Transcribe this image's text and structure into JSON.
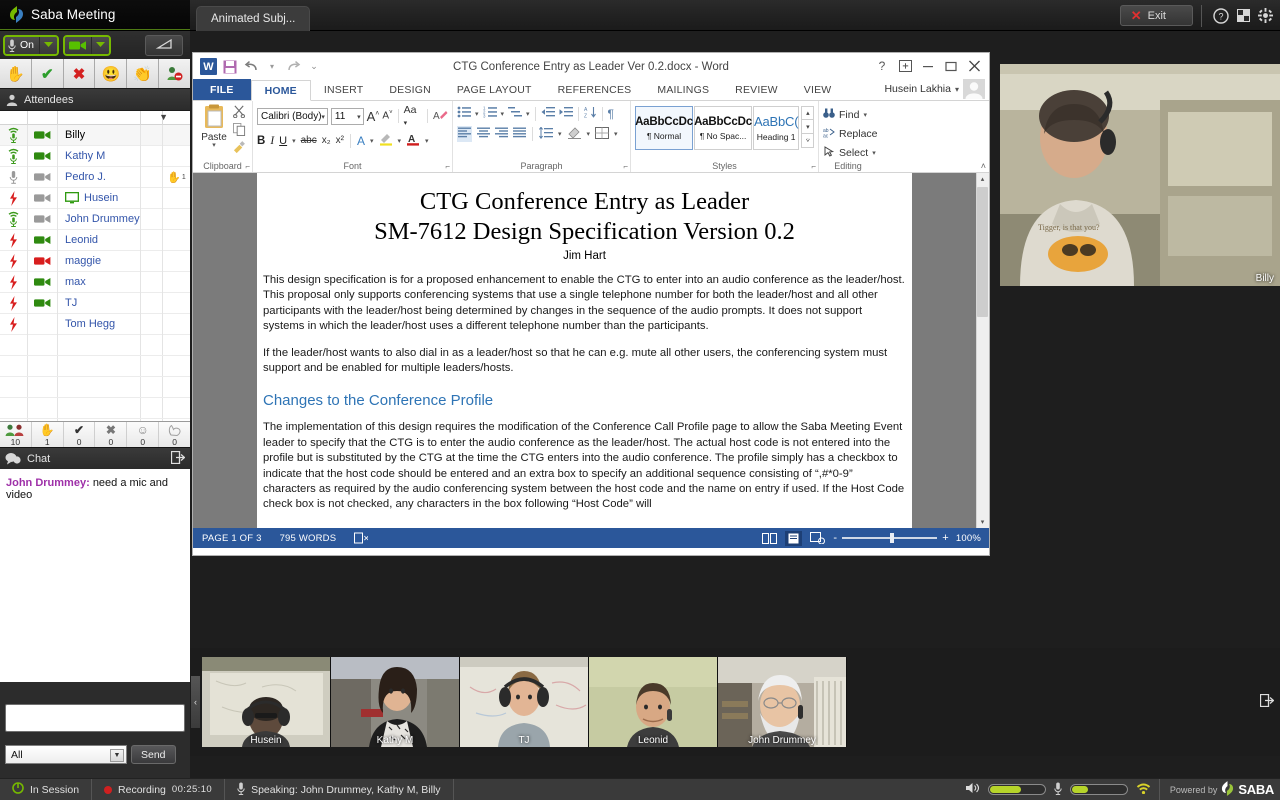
{
  "app": {
    "brand": "Saba Meeting",
    "brand_icon": "saba-leaf-icon",
    "tab_label": "Animated Subj...",
    "exit_label": "Exit",
    "help_icon": "question-circle-icon",
    "layout_icon": "layout-icon",
    "settings_icon": "gear-icon",
    "accent_green": "#76b900"
  },
  "av_controls": {
    "mic_icon": "microphone-icon",
    "mic_state": "On",
    "mic_dropdown_icon": "chevron-down-icon",
    "cam_icon": "video-camera-icon",
    "cam_dropdown_icon": "chevron-down-icon",
    "pen_icon": "pointer-pen-icon"
  },
  "emoticons": [
    {
      "name": "raise-hand",
      "glyph": "✋"
    },
    {
      "name": "yes-check",
      "glyph": "✔"
    },
    {
      "name": "no-cross",
      "glyph": "✖"
    },
    {
      "name": "smile",
      "glyph": "😃"
    },
    {
      "name": "applause",
      "glyph": "👏"
    },
    {
      "name": "step-out",
      "glyph": "🚫"
    }
  ],
  "attendees_panel": {
    "title": "Attendees",
    "title_icon": "person-icon",
    "filter_icon": "filter-icon",
    "rows": [
      {
        "name": "Billy",
        "audio": "wifi-mic-green",
        "video": "camera-green",
        "host": true,
        "hand": false,
        "monitor": false
      },
      {
        "name": "Kathy M",
        "audio": "wifi-mic-green",
        "video": "camera-green",
        "host": false,
        "hand": false,
        "monitor": false
      },
      {
        "name": "Pedro J.",
        "audio": "mic-grey",
        "video": "camera-grey",
        "host": false,
        "hand": true,
        "monitor": false
      },
      {
        "name": "Husein",
        "audio": "bolt-red",
        "video": "camera-grey",
        "host": false,
        "hand": false,
        "monitor": true
      },
      {
        "name": "John Drummey",
        "audio": "wifi-mic-green",
        "video": "camera-grey",
        "host": false,
        "hand": false,
        "monitor": false
      },
      {
        "name": "Leonid",
        "audio": "bolt-red",
        "video": "camera-green",
        "host": false,
        "hand": false,
        "monitor": false
      },
      {
        "name": "maggie",
        "audio": "bolt-red",
        "video": "camera-red",
        "host": false,
        "hand": false,
        "monitor": false
      },
      {
        "name": "max",
        "audio": "bolt-red",
        "video": "camera-green",
        "host": false,
        "hand": false,
        "monitor": false
      },
      {
        "name": "TJ",
        "audio": "bolt-red",
        "video": "camera-green",
        "host": false,
        "hand": false,
        "monitor": false
      },
      {
        "name": "Tom Hegg",
        "audio": "bolt-red",
        "video": "none",
        "host": false,
        "hand": false,
        "monitor": false
      }
    ],
    "hand_count_marker": "1",
    "stats": [
      {
        "icon": "people-icon",
        "glyph": "👥",
        "count": "10"
      },
      {
        "icon": "hand-icon",
        "glyph": "✋",
        "count": "1"
      },
      {
        "icon": "check-icon",
        "glyph": "✔",
        "count": "0"
      },
      {
        "icon": "cross-icon",
        "glyph": "✖",
        "count": "0"
      },
      {
        "icon": "smile-icon",
        "glyph": "☺",
        "count": "0"
      },
      {
        "icon": "applause-icon",
        "glyph": "👏",
        "count": "0"
      }
    ]
  },
  "chat": {
    "title": "Chat",
    "title_icon": "chat-bubbles-icon",
    "popout_icon": "popout-icon",
    "messages": [
      {
        "sender": "John Drummey:",
        "text": "need a mic and video"
      }
    ],
    "input_value": "",
    "input_placeholder": "",
    "recipient": "All",
    "recipient_caret_icon": "chevron-down-icon",
    "send_label": "Send"
  },
  "word": {
    "app_icon": "word-w-icon",
    "quick_access": [
      {
        "name": "save-icon",
        "glyph": "💾"
      },
      {
        "name": "undo-icon",
        "glyph": "↶"
      },
      {
        "name": "redo-icon",
        "glyph": "↷"
      },
      {
        "name": "customize-qat-icon",
        "glyph": "⌄"
      }
    ],
    "title": "CTG Conference Entry as Leader Ver 0.2.docx - Word",
    "window_controls": [
      {
        "name": "help-icon",
        "glyph": "?"
      },
      {
        "name": "ribbon-display-options-icon",
        "glyph": "⊞"
      },
      {
        "name": "minimize-icon",
        "glyph": "—"
      },
      {
        "name": "restore-icon",
        "glyph": "❐"
      },
      {
        "name": "close-icon",
        "glyph": "✕"
      }
    ],
    "tabs": [
      {
        "label": "FILE",
        "kind": "file"
      },
      {
        "label": "HOME",
        "kind": "active"
      },
      {
        "label": "INSERT",
        "kind": "normal"
      },
      {
        "label": "DESIGN",
        "kind": "normal"
      },
      {
        "label": "PAGE LAYOUT",
        "kind": "normal"
      },
      {
        "label": "REFERENCES",
        "kind": "normal"
      },
      {
        "label": "MAILINGS",
        "kind": "normal"
      },
      {
        "label": "REVIEW",
        "kind": "normal"
      },
      {
        "label": "VIEW",
        "kind": "normal"
      }
    ],
    "account_name": "Husein Lakhia",
    "account_caret_icon": "chevron-down-icon",
    "account_avatar_icon": "user-avatar-icon",
    "ribbon": {
      "groups": [
        {
          "label": "Clipboard",
          "dialog": true
        },
        {
          "label": "Font",
          "dialog": true
        },
        {
          "label": "Paragraph",
          "dialog": true
        },
        {
          "label": "Styles",
          "dialog": true
        },
        {
          "label": "Editing",
          "dialog": false
        }
      ],
      "clipboard": {
        "paste_label": "Paste",
        "paste_icon": "clipboard-icon",
        "cut_icon": "scissors-icon",
        "copy_icon": "copy-icon",
        "format_painter_icon": "paintbrush-icon"
      },
      "font": {
        "font_name": "Calibri (Body)",
        "font_size": "11",
        "grow_icon": "grow-font-icon",
        "shrink_icon": "shrink-font-icon",
        "change_case_label": "Aa",
        "clear_formatting_icon": "clear-formatting-icon",
        "bold": "B",
        "italic": "I",
        "underline": "U",
        "strike": "abc",
        "subscript": "x₂",
        "superscript": "x²",
        "text_effects_icon": "text-effects-icon",
        "highlight_icon": "highlight-icon",
        "font_color_icon": "font-color-icon"
      },
      "paragraph": {
        "bullets_icon": "bullet-list-icon",
        "numbering_icon": "numbered-list-icon",
        "multilevel_icon": "multilevel-list-icon",
        "decrease_indent_icon": "decrease-indent-icon",
        "increase_indent_icon": "increase-indent-icon",
        "sort_icon": "sort-icon",
        "show_marks_icon": "pilcrow-icon",
        "align_left_icon": "align-left-icon",
        "align_center_icon": "align-center-icon",
        "align_right_icon": "align-right-icon",
        "justify_icon": "justify-icon",
        "line_spacing_icon": "line-spacing-icon",
        "shading_icon": "shading-icon",
        "borders_icon": "borders-icon"
      },
      "styles": [
        {
          "preview": "AaBbCcDc",
          "name": "¶ Normal",
          "selected": true,
          "kind": "body"
        },
        {
          "preview": "AaBbCcDc",
          "name": "¶ No Spac...",
          "selected": false,
          "kind": "body"
        },
        {
          "preview": "AaBbC(",
          "name": "Heading 1",
          "selected": false,
          "kind": "h1"
        }
      ],
      "styles_scroll_icons": [
        "up-arrow-icon",
        "down-arrow-icon",
        "more-styles-icon"
      ],
      "editing": [
        {
          "label": "Find",
          "icon": "binoculars-icon",
          "caret": true
        },
        {
          "label": "Replace",
          "icon": "replace-icon",
          "caret": false
        },
        {
          "label": "Select",
          "icon": "select-icon",
          "caret": true
        }
      ],
      "collapse_icon": "collapse-ribbon-icon"
    },
    "document": {
      "title_line1": "CTG Conference Entry as Leader",
      "title_line2": "SM-7612 Design Specification Version 0.2",
      "author": "Jim Hart",
      "paragraph1": "This design specification is for a proposed enhancement to enable the CTG to enter into an audio conference as the leader/host. This proposal only supports conferencing systems that use a single telephone number for both the leader/host and all other participants with the leader/host being determined by changes in the sequence of the audio prompts. It does not support systems in which the leader/host uses a different telephone number than the participants.",
      "paragraph2": "If the leader/host wants to also dial in as a leader/host so that he can e.g. mute all other users, the conferencing system must support and be enabled for multiple leaders/hosts.",
      "heading1": "Changes to the Conference Profile",
      "paragraph3": "The implementation of this design requires the modification of the Conference Call Profile page to allow the Saba Meeting Event leader to specify that the CTG is to enter the audio conference as the leader/host. The actual host code is not entered into the profile but is substituted by the CTG at the time the CTG enters into the audio conference. The profile simply has a checkbox to indicate that the host code should be entered and an extra box to specify an additional sequence consisting of “,#*0-9” characters as required by the audio conferencing system between the host code and the name on entry if used. If the Host Code check box is not checked, any characters in the box following “Host Code” will"
    },
    "status": {
      "page": "PAGE 1 OF 3",
      "words": "795 WORDS",
      "proofing_icon": "proofing-errors-icon",
      "view_read_icon": "read-mode-icon",
      "view_print_icon": "print-layout-icon",
      "view_web_icon": "web-layout-icon",
      "zoom_out": "-",
      "zoom_in": "+",
      "zoom_level": "100%"
    }
  },
  "self_video": {
    "label": "Billy"
  },
  "filmstrip": {
    "left_arrow_icon": "chevron-left-icon",
    "popout_icon": "popout-icon",
    "thumbs": [
      {
        "label": "Husein"
      },
      {
        "label": "Kathy M"
      },
      {
        "label": "TJ"
      },
      {
        "label": "Leonid"
      },
      {
        "label": "John Drummey"
      }
    ]
  },
  "bottom_bar": {
    "session_icon": "power-icon",
    "session_label": "In Session",
    "recording_label": "Recording",
    "recording_time": "00:25:10",
    "speaking_icon": "microphone-icon",
    "speaking_label": "Speaking: John Drummey, Kathy M, Billy",
    "speaker_icon": "speaker-icon",
    "speaker_level": 55,
    "mic_icon": "microphone-icon",
    "mic_level": 28,
    "network_icon": "wifi-icon",
    "powered_by": "Powered by",
    "powered_brand": "SABA"
  }
}
